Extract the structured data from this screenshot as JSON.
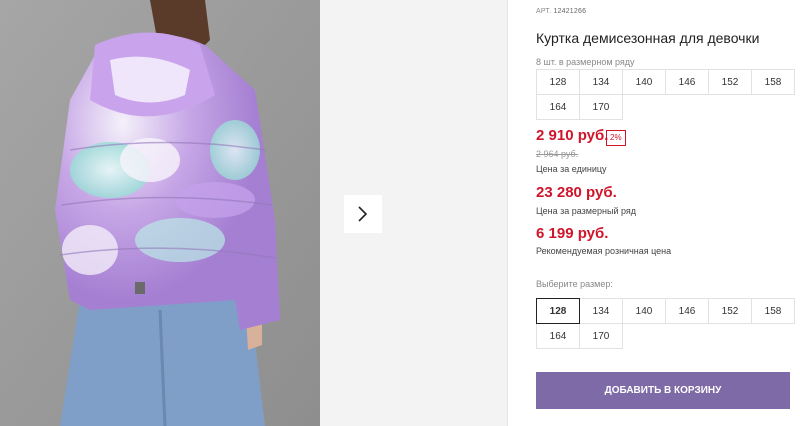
{
  "gallery": {
    "next_icon": "chevron-right-icon",
    "bg_color": "#9a9a9a",
    "jacket_colors": [
      "#b58ad8",
      "#a8e6e0",
      "#f2eef8",
      "#c7b2f0"
    ]
  },
  "product": {
    "art_label": "АРТ.",
    "art_value": "12421266",
    "title": "Куртка демисезонная для девочки",
    "row_note": "8 шт. в размерном ряду",
    "row_sizes": [
      "128",
      "134",
      "140",
      "146",
      "152",
      "158",
      "164",
      "170"
    ],
    "price": "2 910 руб.",
    "discount": "2%",
    "old_price": "2 964 руб.",
    "price_unit_caption": "Цена за единицу",
    "row_price": "23 280 руб.",
    "row_price_caption": "Цена за размерный ряд",
    "rrp_price": "6 199 руб.",
    "rrp_caption": "Рекомендуемая розничная цена",
    "choose_size_label": "Выберите размер:",
    "choose_sizes": [
      "128",
      "134",
      "140",
      "146",
      "152",
      "158",
      "164",
      "170"
    ],
    "selected_size": "128",
    "add_to_cart": "ДОБАВИТЬ В КОРЗИНУ"
  },
  "colors": {
    "price": "#d0152a",
    "button": "#7d6aa6"
  }
}
